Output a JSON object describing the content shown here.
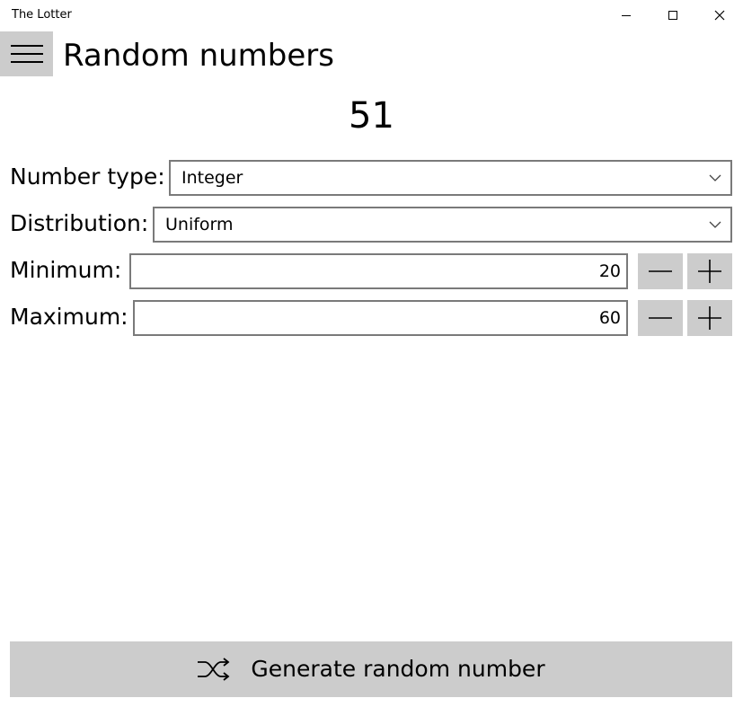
{
  "window": {
    "title": "The Lotter"
  },
  "header": {
    "title": "Random numbers"
  },
  "result": {
    "value": "51"
  },
  "form": {
    "number_type": {
      "label": "Number type:",
      "selected": "Integer"
    },
    "distribution": {
      "label": "Distribution:",
      "selected": "Uniform"
    },
    "minimum": {
      "label": "Minimum:",
      "value": "20"
    },
    "maximum": {
      "label": "Maximum:",
      "value": "60"
    }
  },
  "actions": {
    "generate_label": "Generate random number"
  },
  "colors": {
    "button_bg": "#cccccc",
    "input_border": "#7a7a7a",
    "background": "#ffffff",
    "text": "#000000"
  },
  "icons": {
    "menu": "hamburger-menu-icon",
    "minimize": "minimize-icon",
    "maximize": "maximize-icon",
    "close": "close-icon",
    "dropdown": "chevron-down-icon",
    "decrement": "minus-icon",
    "increment": "plus-icon",
    "generate": "shuffle-icon"
  }
}
